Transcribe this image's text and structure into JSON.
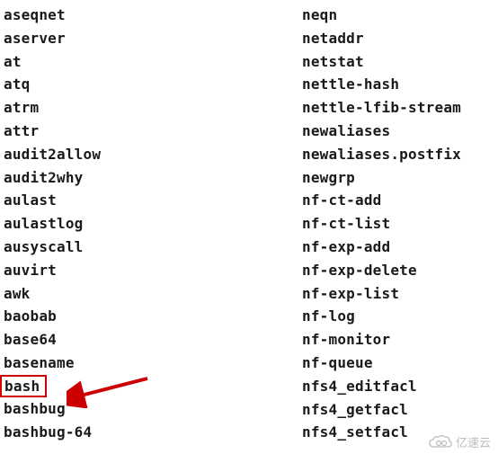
{
  "columns": {
    "left": [
      "aseqnet",
      "aserver",
      "at",
      "atq",
      "atrm",
      "attr",
      "audit2allow",
      "audit2why",
      "aulast",
      "aulastlog",
      "ausyscall",
      "auvirt",
      "awk",
      "baobab",
      "base64",
      "basename",
      "bash",
      "bashbug",
      "bashbug-64"
    ],
    "right": [
      "neqn",
      "netaddr",
      "netstat",
      "nettle-hash",
      "nettle-lfib-stream",
      "newaliases",
      "newaliases.postfix",
      "newgrp",
      "nf-ct-add",
      "nf-ct-list",
      "nf-exp-add",
      "nf-exp-delete",
      "nf-exp-list",
      "nf-log",
      "nf-monitor",
      "nf-queue",
      "nfs4_editfacl",
      "nfs4_getfacl",
      "nfs4_setfacl"
    ]
  },
  "highlighted_index": 16,
  "watermark": {
    "text": "亿速云"
  }
}
